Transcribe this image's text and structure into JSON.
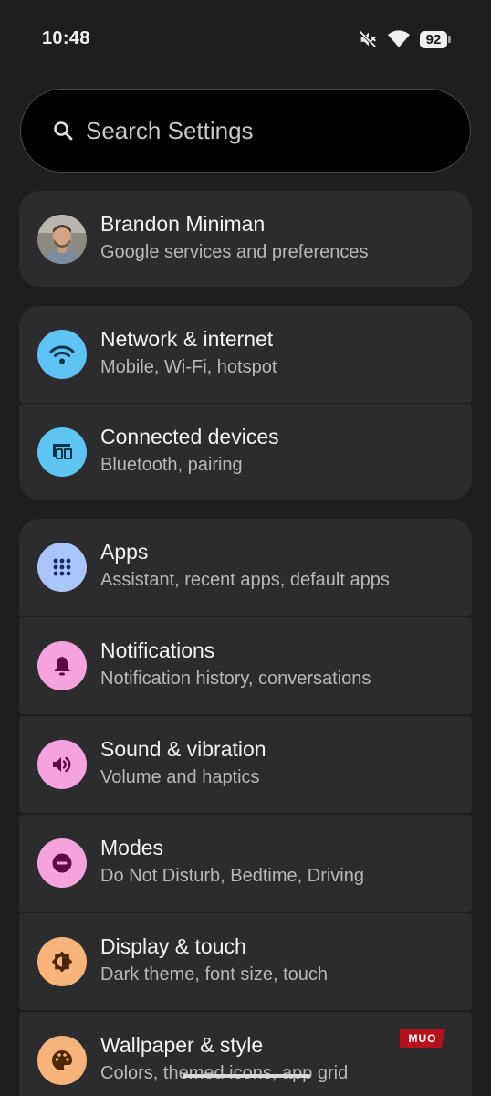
{
  "status_bar": {
    "time": "10:48",
    "battery": "92",
    "icons": [
      "mute-icon",
      "wifi-icon",
      "battery-icon"
    ]
  },
  "search": {
    "placeholder": "Search Settings"
  },
  "account": {
    "name": "Brandon Miniman",
    "subtitle": "Google services and preferences"
  },
  "groups": [
    {
      "items": [
        {
          "title": "Network & internet",
          "subtitle": "Mobile, Wi-Fi, hotspot",
          "icon": "wifi-icon",
          "icon_bg": "#5ec4f2",
          "icon_fg": "#073447"
        },
        {
          "title": "Connected devices",
          "subtitle": "Bluetooth, pairing",
          "icon": "devices-icon",
          "icon_bg": "#5ec4f2",
          "icon_fg": "#073447"
        }
      ]
    },
    {
      "items": [
        {
          "title": "Apps",
          "subtitle": "Assistant, recent apps, default apps",
          "icon": "apps-grid-icon",
          "icon_bg": "#a9c5fb",
          "icon_fg": "#0f2a66"
        },
        {
          "title": "Notifications",
          "subtitle": "Notification history, conversations",
          "icon": "bell-icon",
          "icon_bg": "#f5a3dc",
          "icon_fg": "#5c0a45"
        },
        {
          "title": "Sound & vibration",
          "subtitle": "Volume and haptics",
          "icon": "speaker-icon",
          "icon_bg": "#f5a3dc",
          "icon_fg": "#5c0a45"
        },
        {
          "title": "Modes",
          "subtitle": "Do Not Disturb, Bedtime, Driving",
          "icon": "do-not-disturb-icon",
          "icon_bg": "#f5a3dc",
          "icon_fg": "#5c0a45"
        },
        {
          "title": "Display & touch",
          "subtitle": "Dark theme, font size, touch",
          "icon": "brightness-icon",
          "icon_bg": "#f7b47a",
          "icon_fg": "#4c2606"
        },
        {
          "title": "Wallpaper & style",
          "subtitle": "Colors, themed icons, app grid",
          "icon": "palette-icon",
          "icon_bg": "#f7b47a",
          "icon_fg": "#4c2606"
        }
      ]
    }
  ],
  "watermark": "MUO"
}
